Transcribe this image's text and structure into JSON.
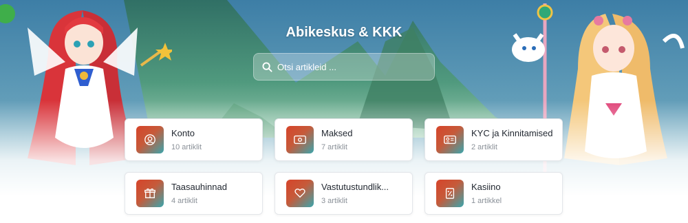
{
  "header": {
    "title": "Abikeskus & KKK"
  },
  "search": {
    "placeholder": "Otsi artikleid ..."
  },
  "categories": [
    {
      "title": "Konto",
      "count": "10 artiklit",
      "icon": "user-circle-icon"
    },
    {
      "title": "Maksed",
      "count": "7 artiklit",
      "icon": "banknote-icon"
    },
    {
      "title": "KYC ja Kinnitamised",
      "count": "2 artiklit",
      "icon": "id-card-icon"
    },
    {
      "title": "Taasauhinnad",
      "count": "4 artiklit",
      "icon": "gift-icon"
    },
    {
      "title": "Vastutustundlik...",
      "count": "3 artiklit",
      "icon": "heart-icon"
    },
    {
      "title": "Kasiino",
      "count": "1 artikkel",
      "icon": "percent-ticket-icon"
    }
  ],
  "colors": {
    "icon_gradient_start": "#d6442a",
    "icon_gradient_end": "#3aa6ad",
    "title_text": "#ffffff",
    "card_title": "#222831",
    "card_count": "#8a9098"
  }
}
